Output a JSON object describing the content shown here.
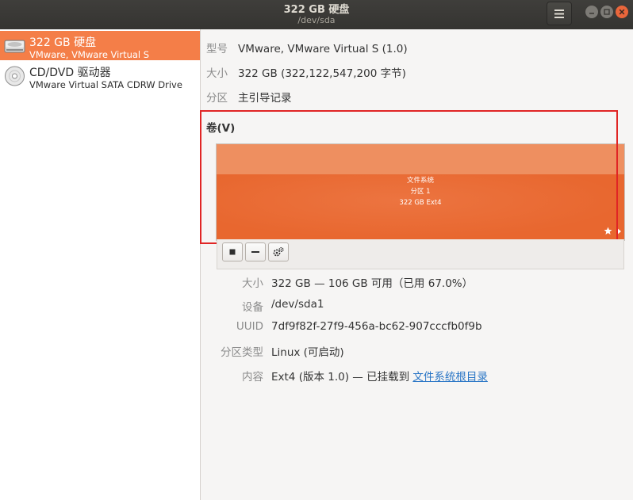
{
  "window": {
    "title": "322 GB 硬盘",
    "subtitle": "/dev/sda"
  },
  "sidebar": {
    "items": [
      {
        "name": "322 GB 硬盘",
        "description": "VMware, VMware Virtual S",
        "selected": true,
        "icon": "hard-disk-icon"
      },
      {
        "name": "CD/DVD 驱动器",
        "description": "VMware Virtual SATA CDRW Drive",
        "selected": false,
        "icon": "optical-disc-icon"
      }
    ]
  },
  "drive_info": {
    "model_label": "型号",
    "model_value": "VMware, VMware Virtual S (1.0)",
    "size_label": "大小",
    "size_value": "322 GB (322,122,547,200 字节)",
    "partitioning_label": "分区",
    "partitioning_value": "主引导记录"
  },
  "volumes": {
    "title": "卷(V)",
    "partition": {
      "line1": "文件系统",
      "line2": "分区 1",
      "line3": "322 GB Ext4"
    }
  },
  "details": {
    "size_label": "大小",
    "size_value": "322 GB — 106 GB 可用（已用 67.0%）",
    "device_label": "设备",
    "device_value": "/dev/sda1",
    "uuid_label": "UUID",
    "uuid_value": "7df9f82f-27f9-456a-bc62-907cccfb0f9b",
    "part_type_label": "分区类型",
    "part_type_value": "Linux (可启动)",
    "contents_label": "内容",
    "contents_value": "Ext4 (版本 1.0) — 已挂载到 ",
    "contents_link": "文件系统根目录"
  },
  "colors": {
    "accent": "#f47e48",
    "partition": "#e96b33",
    "header": "#3c3b37",
    "highlight_box": "#e02525",
    "link": "#2a76c6"
  }
}
